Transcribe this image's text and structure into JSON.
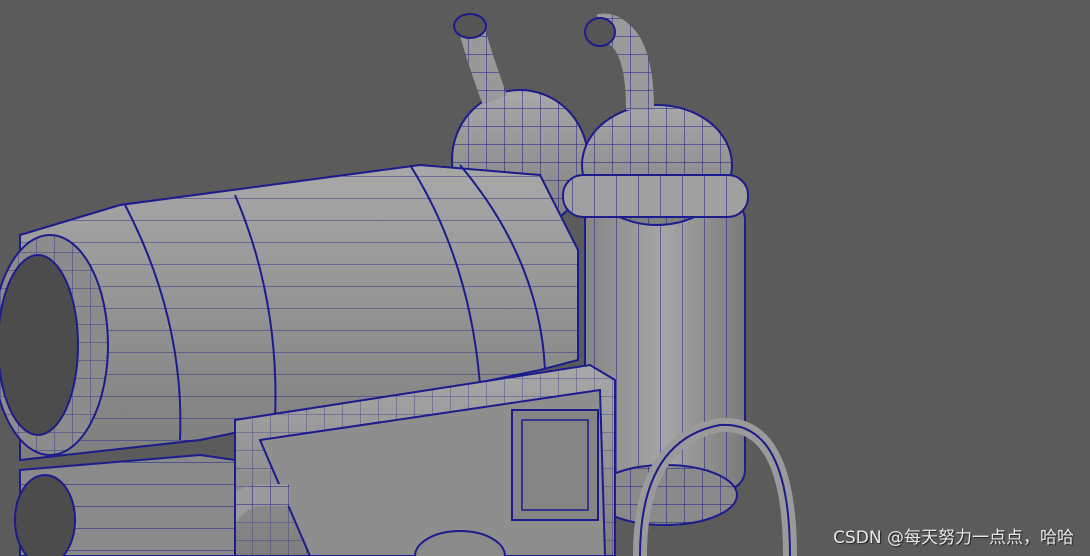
{
  "viewport": {
    "background_color": "#5b5b5b",
    "mesh_color": "#9b9b9b",
    "wire_color": "#1c1c8c",
    "model": "steam-cannon-wireframe"
  },
  "watermark": {
    "text": "CSDN @每天努力一点点，哈哈"
  }
}
